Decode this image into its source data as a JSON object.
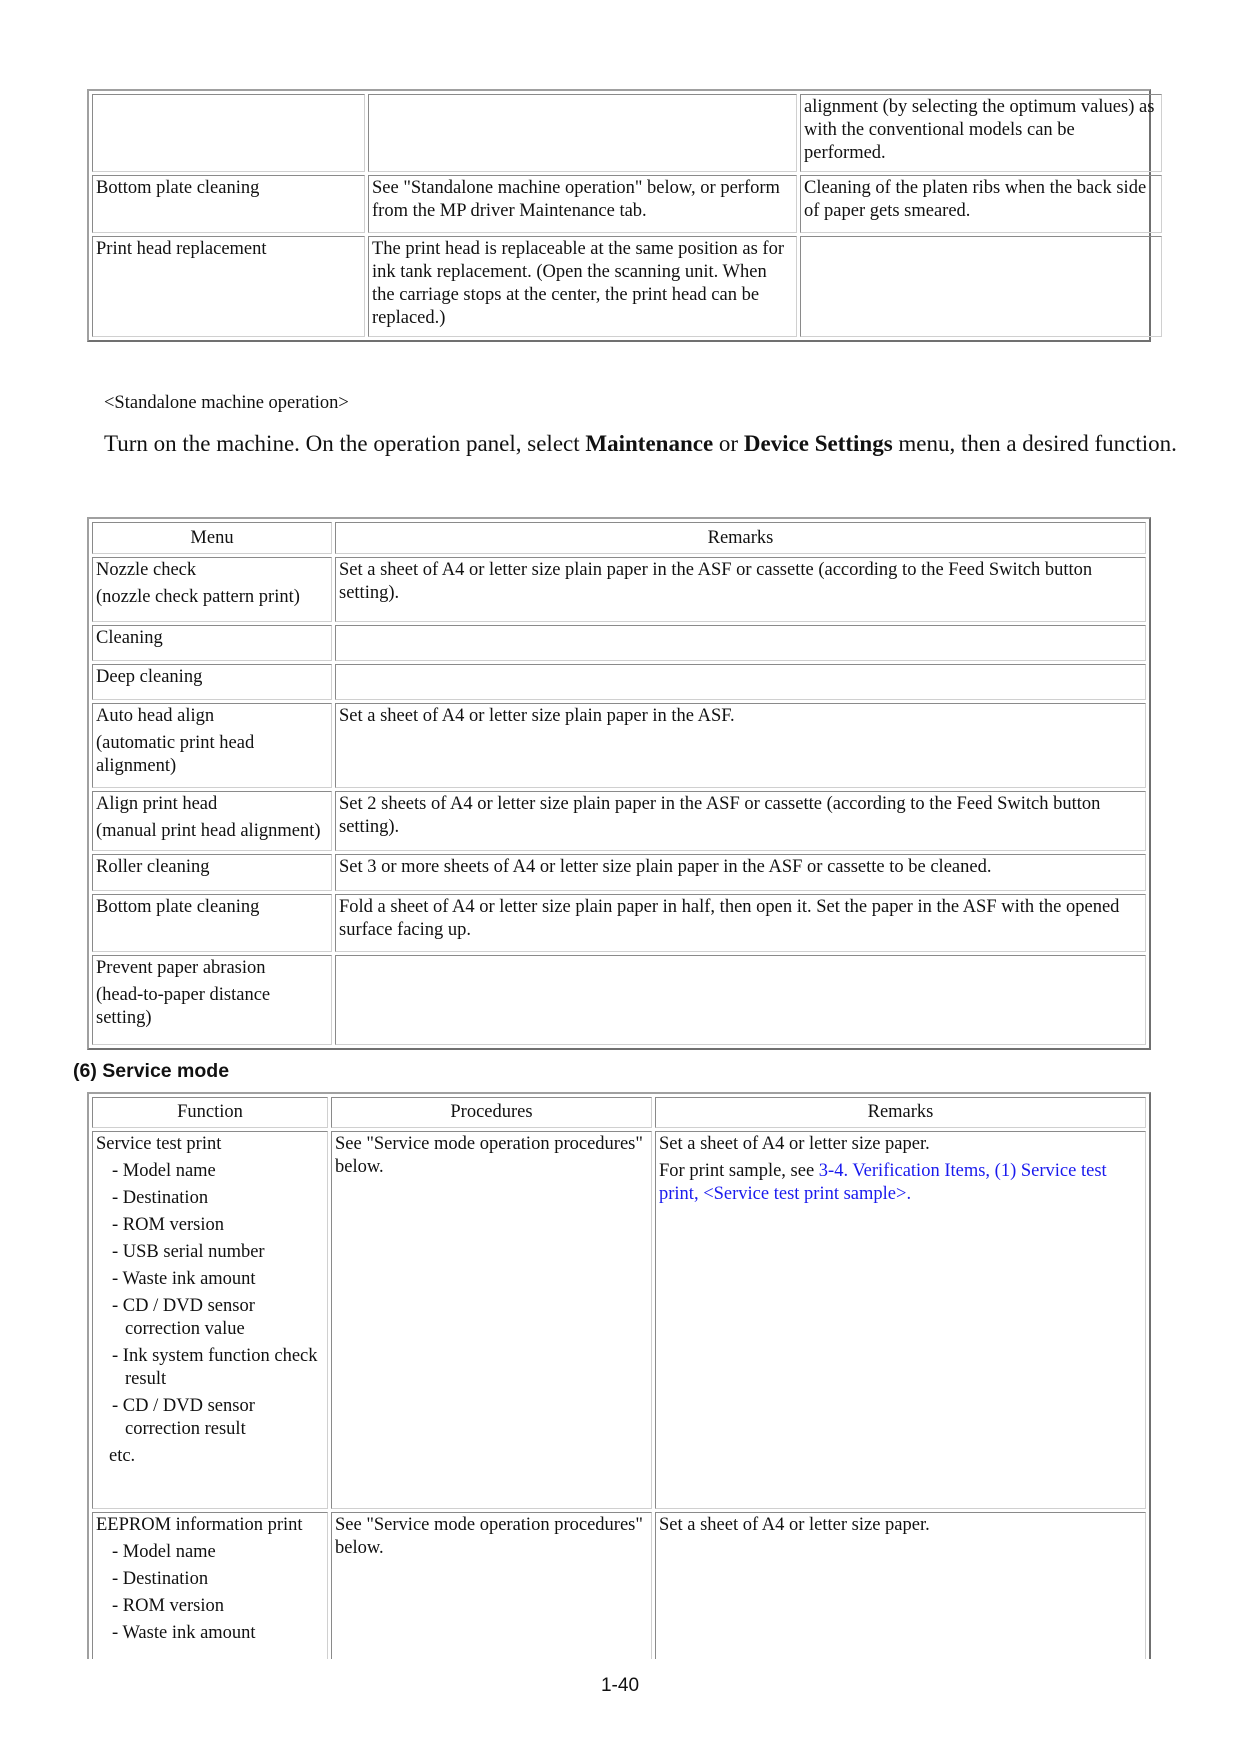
{
  "table_top": {
    "col_widths": [
      273,
      429,
      362
    ],
    "rows": [
      {
        "cells": [
          [
            ""
          ],
          [
            ""
          ],
          [
            "alignment (by selecting the optimum values) as with the conventional models can be performed."
          ]
        ]
      },
      {
        "cells": [
          [
            "Bottom plate cleaning"
          ],
          [
            "See \"Standalone machine operation\" below, or perform from the MP driver Maintenance tab."
          ],
          [
            "Cleaning of the platen ribs when the back side of paper gets smeared."
          ]
        ]
      },
      {
        "cells": [
          [
            "Print head replacement"
          ],
          [
            "The print head is replaceable at the same position as for ink tank replacement. (Open the scanning unit. When the carriage stops at the center, the print head can be replaced.)"
          ],
          [
            ""
          ]
        ]
      }
    ]
  },
  "standalone": {
    "label": "<Standalone machine operation>",
    "intro": [
      {
        "text": "Turn on the machine. On the operation panel, select ",
        "bold": false
      },
      {
        "text": "Maintenance",
        "bold": true
      },
      {
        "text": " or ",
        "bold": false
      },
      {
        "text": "Device Settings",
        "bold": true
      },
      {
        "text": " menu, then a desired function.",
        "bold": false
      }
    ]
  },
  "table_menu": {
    "headers": [
      "Menu",
      "Remarks"
    ],
    "rows": [
      {
        "cells": [
          [
            "Nozzle check",
            "(nozzle check pattern print)"
          ],
          [
            "Set a sheet of A4 or letter size plain paper in the ASF or cassette (according to the Feed Switch button setting)."
          ]
        ]
      },
      {
        "cells": [
          [
            "Cleaning"
          ],
          [
            ""
          ]
        ]
      },
      {
        "cells": [
          [
            "Deep cleaning"
          ],
          [
            ""
          ]
        ]
      },
      {
        "cells": [
          [
            "Auto head align",
            " (automatic print head alignment)"
          ],
          [
            "Set a sheet of A4 or letter size plain paper in the ASF."
          ]
        ]
      },
      {
        "cells": [
          [
            "Align print head",
            "(manual print head alignment)"
          ],
          [
            "Set 2 sheets of A4 or letter size plain paper in the ASF or cassette (according to the Feed Switch button setting)."
          ]
        ]
      },
      {
        "cells": [
          [
            "Roller cleaning"
          ],
          [
            "Set 3 or more sheets of A4 or letter size plain paper in the ASF or cassette to be cleaned."
          ]
        ]
      },
      {
        "cells": [
          [
            "Bottom plate cleaning"
          ],
          [
            "Fold a sheet of A4 or letter size plain paper in half, then open it. Set the paper in the ASF with the opened surface facing up."
          ]
        ]
      },
      {
        "cells": [
          [
            "Prevent paper abrasion",
            "(head-to-paper distance setting)"
          ],
          [
            ""
          ]
        ]
      }
    ]
  },
  "service_mode": {
    "heading": "(6)  Service mode",
    "headers": [
      "Function",
      "Procedures",
      "Remarks"
    ],
    "rows": [
      {
        "function": [
          "Service test print",
          "- Model name",
          "- Destination",
          "- ROM version",
          "- USB serial number",
          "- Waste ink amount",
          "- CD / DVD sensor correction value",
          "- Ink system function check result",
          "- CD / DVD sensor correction result",
          "etc."
        ],
        "procedures": [
          "See \"Service mode operation procedures\" below."
        ],
        "remarks": [
          "Set a sheet of A4 or letter size paper."
        ],
        "remarks_link_prefix": "For print sample, see ",
        "remarks_link": "3-4. Verification Items, (1) Service test print, <Service test print sample>."
      },
      {
        "function": [
          "EEPROM information print",
          "- Model name",
          "- Destination",
          "- ROM version",
          "- Waste ink amount"
        ],
        "procedures": [
          "See \"Service mode operation procedures\" below."
        ],
        "remarks": [
          "Set a sheet of A4 or letter size paper."
        ]
      }
    ]
  },
  "page_number": "1-40",
  "colors": {
    "link": "#1a1aee",
    "border": "#8a8a8a"
  }
}
